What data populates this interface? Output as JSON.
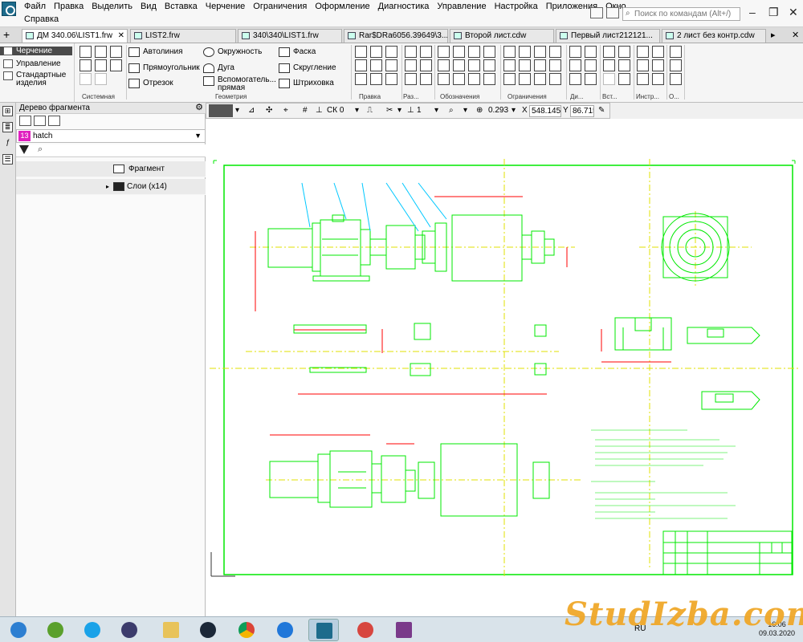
{
  "menu": {
    "items": [
      "Файл",
      "Правка",
      "Выделить",
      "Вид",
      "Вставка",
      "Черчение",
      "Ограничения",
      "Оформление",
      "Диагностика",
      "Управление",
      "Настройка",
      "Приложения",
      "Окно"
    ],
    "help": "Справка"
  },
  "search": {
    "placeholder": "Поиск по командам (Alt+/)"
  },
  "tabs": [
    {
      "label": "ДМ 340.06\\LIST1.frw",
      "active": true
    },
    {
      "label": "LIST2.frw"
    },
    {
      "label": "340\\340\\LIST1.frw"
    },
    {
      "label": "Rar$DRa6056.39649\\3..."
    },
    {
      "label": "Второй лист.cdw"
    },
    {
      "label": "Первый лист212121..."
    },
    {
      "label": "2 лист без контр.cdw"
    }
  ],
  "ribbon": {
    "modes": [
      "Черчение",
      "Управление",
      "Стандартные изделия"
    ],
    "geometry": [
      "Автолиния",
      "Прямоугольник",
      "Отрезок",
      "Окружность",
      "Дуга",
      "Вспомогатель... прямая",
      "Фаска",
      "Скругление",
      "Штриховка"
    ],
    "groups": [
      "Системная",
      "Геометрия",
      "Правка",
      "Раз...",
      "Обозначения",
      "Ограничения",
      "Ди...",
      "Вст...",
      "Инстр...",
      "О..."
    ]
  },
  "cad_toolbar": {
    "cs": "СК 0",
    "layer": "1",
    "zoom": "0.293",
    "x_label": "X",
    "x_value": "548.1459",
    "y_label": "Y",
    "y_value": "86.71522"
  },
  "panel": {
    "title": "Дерево фрагмента",
    "hatch_number": "13",
    "hatch_name": "hatch",
    "tree": [
      {
        "label": "Фрагмент"
      },
      {
        "label": "Слои (x14)"
      }
    ]
  },
  "taskbar": {
    "time": "16:06",
    "date": "09.03.2020",
    "lang": "RU"
  },
  "watermark": "StudIzba.com",
  "colors": {
    "drawing": "#00e800",
    "axis": "#e0e000",
    "dimension": "#ff0000",
    "leader": "#00c8ff",
    "watermark": "#f0a82a"
  }
}
